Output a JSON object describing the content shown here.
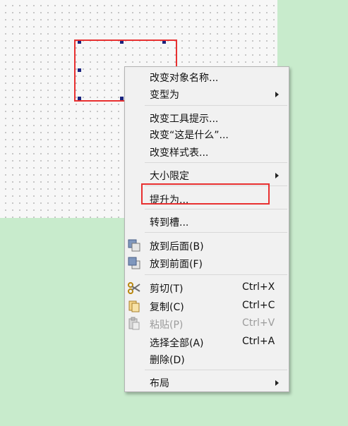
{
  "context_menu": {
    "rename_object": "改变对象名称...",
    "morph_into": "变型为",
    "change_tooltip": "改变工具提示...",
    "change_whatsthis": "改变“这是什么”...",
    "change_stylesheet": "改变样式表...",
    "size_constraints": "大小限定",
    "promote_to": "提升为...",
    "go_to_slot": "转到槽...",
    "send_to_back": "放到后面(B)",
    "bring_to_front": "放到前面(F)",
    "cut": "剪切(T)",
    "cut_shortcut": "Ctrl+X",
    "copy": "复制(C)",
    "copy_shortcut": "Ctrl+C",
    "paste": "粘贴(P)",
    "paste_shortcut": "Ctrl+V",
    "select_all": "选择全部(A)",
    "select_all_shortcut": "Ctrl+A",
    "delete": "删除(D)",
    "layout": "布局"
  },
  "colors": {
    "background": "#c8ebcc",
    "highlight": "#e83030",
    "selection_handle": "#1a237e",
    "menu_bg": "#f1f1f1",
    "disabled_text": "#9c9c9c"
  }
}
